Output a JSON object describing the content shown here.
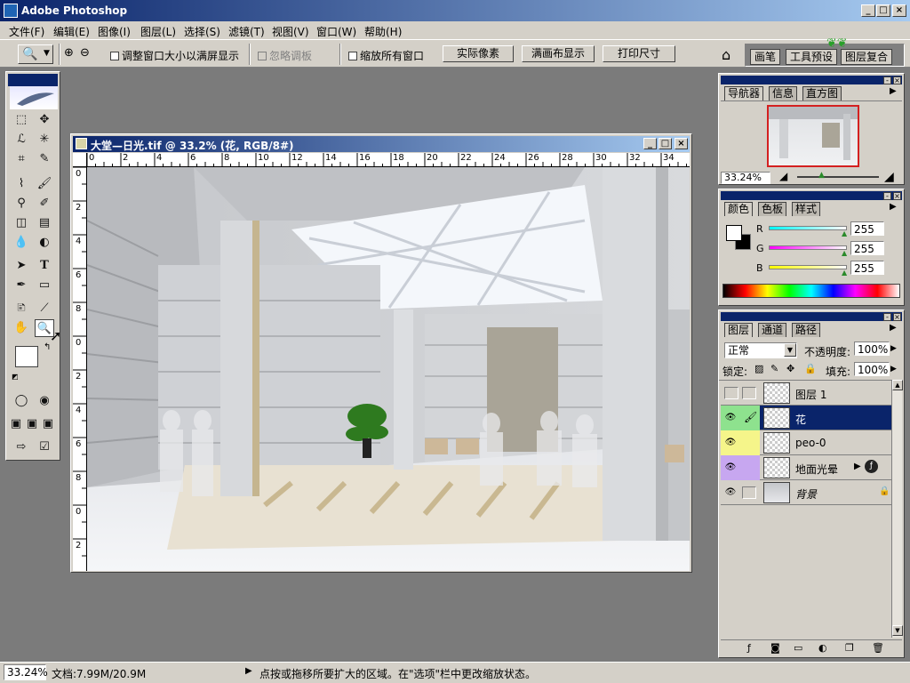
{
  "window": {
    "title": "Adobe Photoshop",
    "min": "_",
    "max": "□",
    "close": "×"
  },
  "menu": [
    "文件(F)",
    "编辑(E)",
    "图像(I)",
    "图层(L)",
    "选择(S)",
    "滤镜(T)",
    "视图(V)",
    "窗口(W)",
    "帮助(H)"
  ],
  "options": {
    "resize_windows": "调整窗口大小以满屏显示",
    "ignore_palettes": "忽略调板",
    "zoom_all": "缩放所有窗口",
    "actual_pixels": "实际像素",
    "fit_screen": "满画布显示",
    "print_size": "打印尺寸",
    "well_tabs": [
      "画笔",
      "工具预设",
      "图层复合"
    ]
  },
  "document": {
    "title": "大堂—日光.tif @ 33.2% (花, RGB/8#)",
    "ruler_top": [
      "0",
      "2",
      "4",
      "6",
      "8",
      "10",
      "12",
      "14",
      "16",
      "18",
      "20",
      "22",
      "24",
      "26",
      "28",
      "30",
      "32",
      "34"
    ],
    "ruler_left": [
      "0",
      "2",
      "4",
      "6",
      "8",
      "0",
      "2",
      "4",
      "6",
      "8",
      "0",
      "2"
    ]
  },
  "navigator": {
    "tabs": [
      "导航器",
      "信息",
      "直方图"
    ],
    "zoom": "33.24%"
  },
  "color": {
    "tabs": [
      "颜色",
      "色板",
      "样式"
    ],
    "channels": [
      {
        "label": "R",
        "value": "255"
      },
      {
        "label": "G",
        "value": "255"
      },
      {
        "label": "B",
        "value": "255"
      }
    ]
  },
  "layers": {
    "tabs": [
      "图层",
      "通道",
      "路径"
    ],
    "blend_mode": "正常",
    "opacity_label": "不透明度:",
    "opacity": "100%",
    "lock_label": "锁定:",
    "fill_label": "填充:",
    "fill": "100%",
    "items": [
      {
        "name": "图层 1",
        "color": "#d4d0c8",
        "visible": false,
        "selected": false
      },
      {
        "name": "花",
        "color": "#8ee28e",
        "visible": true,
        "selected": true
      },
      {
        "name": "peo-0",
        "color": "#f5f58a",
        "visible": true,
        "selected": false
      },
      {
        "name": "地面光晕",
        "color": "#c7a7f0",
        "visible": true,
        "selected": false
      },
      {
        "name": "背景",
        "color": "#d4d0c8",
        "visible": true,
        "selected": false
      }
    ]
  },
  "status": {
    "zoom": "33.24%",
    "doc_size": "文档:7.99M/20.9M",
    "hint": "点按或拖移所要扩大的区域。在\"选项\"栏中更改缩放状态。"
  }
}
